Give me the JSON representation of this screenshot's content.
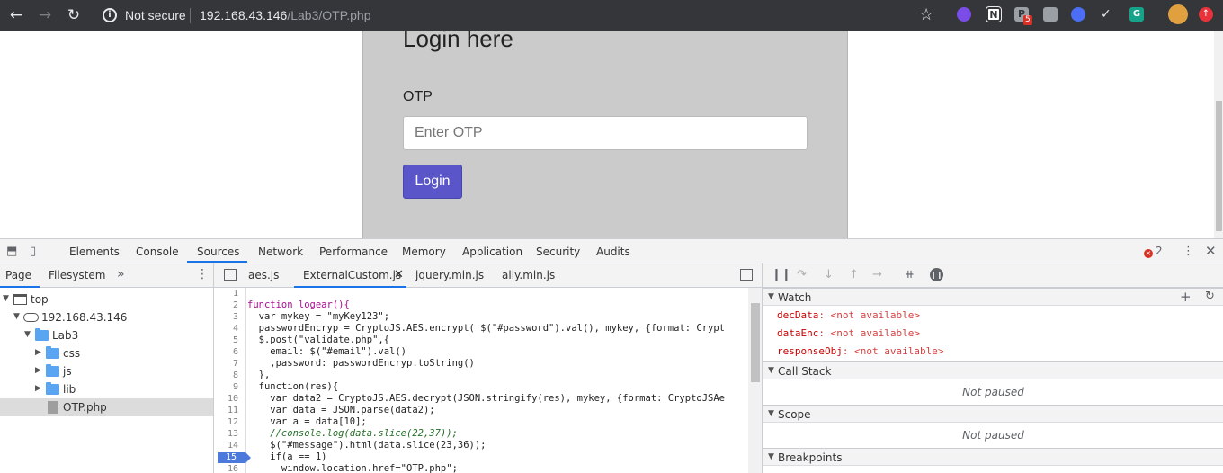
{
  "browser": {
    "security_label": "Not secure",
    "url_host": "192.168.43.146",
    "url_path": "/Lab3/OTP.php",
    "extension_badge": "5"
  },
  "page": {
    "title": "Login here",
    "otp_label": "OTP",
    "otp_placeholder": "Enter OTP",
    "login_button": "Login"
  },
  "devtools": {
    "tabs": [
      "Elements",
      "Console",
      "Sources",
      "Network",
      "Performance",
      "Memory",
      "Application",
      "Security",
      "Audits"
    ],
    "active_tab": "Sources",
    "error_count": "2",
    "navigator": {
      "tabs": [
        "Page",
        "Filesystem"
      ],
      "tree": [
        {
          "label": "top"
        },
        {
          "label": "192.168.43.146"
        },
        {
          "label": "Lab3"
        },
        {
          "label": "css"
        },
        {
          "label": "js"
        },
        {
          "label": "lib"
        },
        {
          "label": "OTP.php"
        }
      ]
    },
    "editor": {
      "tabs": [
        "aes.js",
        "ExternalCustom.js",
        "jquery.min.js",
        "ally.min.js"
      ],
      "active_tab": "ExternalCustom.js",
      "breakpoint_line": "15",
      "line_numbers": [
        "1",
        "2",
        "3",
        "4",
        "5",
        "6",
        "7",
        "8",
        "9",
        "10",
        "11",
        "12",
        "13",
        "14",
        "15",
        "16"
      ],
      "lines": [
        "",
        "function logear(){",
        "  var mykey = \"myKey123\";",
        "  passwordEncryp = CryptoJS.AES.encrypt( $(\"#password\").val(), mykey, {format: Crypt",
        "  $.post(\"validate.php\",{",
        "    email: $(\"#email\").val()",
        "    ,password: passwordEncryp.toString()",
        "  },",
        "  function(res){",
        "    var data2 = CryptoJS.AES.decrypt(JSON.stringify(res), mykey, {format: CryptoJSAe",
        "    var data = JSON.parse(data2);",
        "    var a = data[10];",
        "    //console.log(data.slice(22,37));",
        "    $(\"#message\").html(data.slice(23,36));",
        "    if(a == 1)",
        "      window.location.href=\"OTP.php\";"
      ]
    },
    "sidebar": {
      "watch_title": "Watch",
      "watch": [
        {
          "name": "decData",
          "value": "<not available>"
        },
        {
          "name": "dataEnc",
          "value": "<not available>"
        },
        {
          "name": "responseObj",
          "value": "<not available>"
        }
      ],
      "call_stack_title": "Call Stack",
      "call_stack_status": "Not paused",
      "scope_title": "Scope",
      "scope_status": "Not paused",
      "breakpoints_title": "Breakpoints"
    }
  }
}
